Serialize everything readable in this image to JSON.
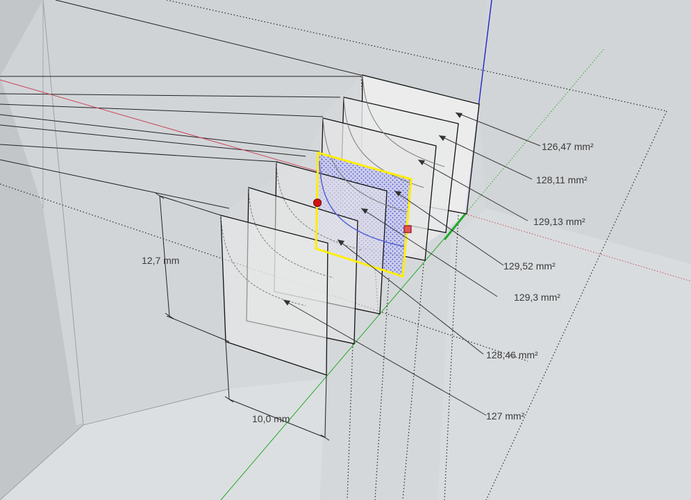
{
  "viewport": {
    "background": "#d6d8da",
    "axis_colors": {
      "red": "#c9475a",
      "green": "#1faa2a",
      "blue": "#2222cc"
    },
    "selection_color": "#ffee00"
  },
  "dimensions": {
    "height": "12,7 mm",
    "width": "10,0 mm"
  },
  "area_labels": [
    {
      "text": "126,47 mm²"
    },
    {
      "text": "128,11 mm²"
    },
    {
      "text": "129,13 mm²"
    },
    {
      "text": "129,52 mm²"
    },
    {
      "text": "129,3 mm²"
    },
    {
      "text": "128,46 mm²"
    },
    {
      "text": "127 mm²"
    }
  ]
}
